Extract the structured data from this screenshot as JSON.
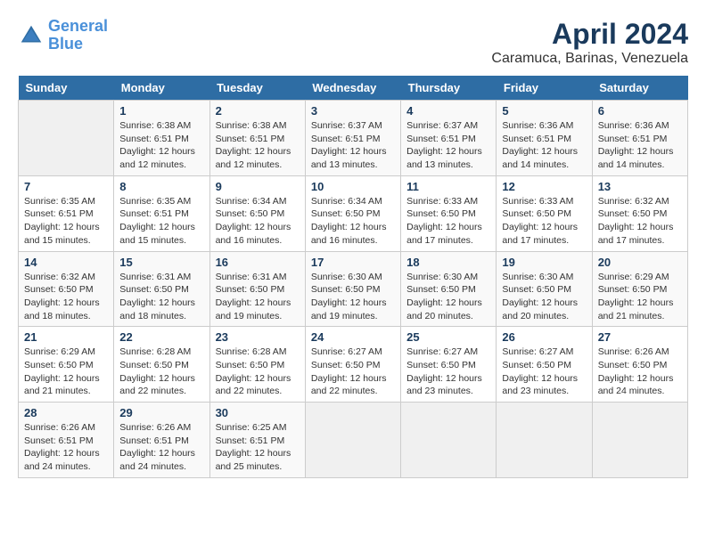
{
  "header": {
    "logo_line1": "General",
    "logo_line2": "Blue",
    "title": "April 2024",
    "subtitle": "Caramuca, Barinas, Venezuela"
  },
  "columns": [
    "Sunday",
    "Monday",
    "Tuesday",
    "Wednesday",
    "Thursday",
    "Friday",
    "Saturday"
  ],
  "weeks": [
    [
      {
        "day": "",
        "sunrise": "",
        "sunset": "",
        "daylight": ""
      },
      {
        "day": "1",
        "sunrise": "Sunrise: 6:38 AM",
        "sunset": "Sunset: 6:51 PM",
        "daylight": "Daylight: 12 hours and 12 minutes."
      },
      {
        "day": "2",
        "sunrise": "Sunrise: 6:38 AM",
        "sunset": "Sunset: 6:51 PM",
        "daylight": "Daylight: 12 hours and 12 minutes."
      },
      {
        "day": "3",
        "sunrise": "Sunrise: 6:37 AM",
        "sunset": "Sunset: 6:51 PM",
        "daylight": "Daylight: 12 hours and 13 minutes."
      },
      {
        "day": "4",
        "sunrise": "Sunrise: 6:37 AM",
        "sunset": "Sunset: 6:51 PM",
        "daylight": "Daylight: 12 hours and 13 minutes."
      },
      {
        "day": "5",
        "sunrise": "Sunrise: 6:36 AM",
        "sunset": "Sunset: 6:51 PM",
        "daylight": "Daylight: 12 hours and 14 minutes."
      },
      {
        "day": "6",
        "sunrise": "Sunrise: 6:36 AM",
        "sunset": "Sunset: 6:51 PM",
        "daylight": "Daylight: 12 hours and 14 minutes."
      }
    ],
    [
      {
        "day": "7",
        "sunrise": "Sunrise: 6:35 AM",
        "sunset": "Sunset: 6:51 PM",
        "daylight": "Daylight: 12 hours and 15 minutes."
      },
      {
        "day": "8",
        "sunrise": "Sunrise: 6:35 AM",
        "sunset": "Sunset: 6:51 PM",
        "daylight": "Daylight: 12 hours and 15 minutes."
      },
      {
        "day": "9",
        "sunrise": "Sunrise: 6:34 AM",
        "sunset": "Sunset: 6:50 PM",
        "daylight": "Daylight: 12 hours and 16 minutes."
      },
      {
        "day": "10",
        "sunrise": "Sunrise: 6:34 AM",
        "sunset": "Sunset: 6:50 PM",
        "daylight": "Daylight: 12 hours and 16 minutes."
      },
      {
        "day": "11",
        "sunrise": "Sunrise: 6:33 AM",
        "sunset": "Sunset: 6:50 PM",
        "daylight": "Daylight: 12 hours and 17 minutes."
      },
      {
        "day": "12",
        "sunrise": "Sunrise: 6:33 AM",
        "sunset": "Sunset: 6:50 PM",
        "daylight": "Daylight: 12 hours and 17 minutes."
      },
      {
        "day": "13",
        "sunrise": "Sunrise: 6:32 AM",
        "sunset": "Sunset: 6:50 PM",
        "daylight": "Daylight: 12 hours and 17 minutes."
      }
    ],
    [
      {
        "day": "14",
        "sunrise": "Sunrise: 6:32 AM",
        "sunset": "Sunset: 6:50 PM",
        "daylight": "Daylight: 12 hours and 18 minutes."
      },
      {
        "day": "15",
        "sunrise": "Sunrise: 6:31 AM",
        "sunset": "Sunset: 6:50 PM",
        "daylight": "Daylight: 12 hours and 18 minutes."
      },
      {
        "day": "16",
        "sunrise": "Sunrise: 6:31 AM",
        "sunset": "Sunset: 6:50 PM",
        "daylight": "Daylight: 12 hours and 19 minutes."
      },
      {
        "day": "17",
        "sunrise": "Sunrise: 6:30 AM",
        "sunset": "Sunset: 6:50 PM",
        "daylight": "Daylight: 12 hours and 19 minutes."
      },
      {
        "day": "18",
        "sunrise": "Sunrise: 6:30 AM",
        "sunset": "Sunset: 6:50 PM",
        "daylight": "Daylight: 12 hours and 20 minutes."
      },
      {
        "day": "19",
        "sunrise": "Sunrise: 6:30 AM",
        "sunset": "Sunset: 6:50 PM",
        "daylight": "Daylight: 12 hours and 20 minutes."
      },
      {
        "day": "20",
        "sunrise": "Sunrise: 6:29 AM",
        "sunset": "Sunset: 6:50 PM",
        "daylight": "Daylight: 12 hours and 21 minutes."
      }
    ],
    [
      {
        "day": "21",
        "sunrise": "Sunrise: 6:29 AM",
        "sunset": "Sunset: 6:50 PM",
        "daylight": "Daylight: 12 hours and 21 minutes."
      },
      {
        "day": "22",
        "sunrise": "Sunrise: 6:28 AM",
        "sunset": "Sunset: 6:50 PM",
        "daylight": "Daylight: 12 hours and 22 minutes."
      },
      {
        "day": "23",
        "sunrise": "Sunrise: 6:28 AM",
        "sunset": "Sunset: 6:50 PM",
        "daylight": "Daylight: 12 hours and 22 minutes."
      },
      {
        "day": "24",
        "sunrise": "Sunrise: 6:27 AM",
        "sunset": "Sunset: 6:50 PM",
        "daylight": "Daylight: 12 hours and 22 minutes."
      },
      {
        "day": "25",
        "sunrise": "Sunrise: 6:27 AM",
        "sunset": "Sunset: 6:50 PM",
        "daylight": "Daylight: 12 hours and 23 minutes."
      },
      {
        "day": "26",
        "sunrise": "Sunrise: 6:27 AM",
        "sunset": "Sunset: 6:50 PM",
        "daylight": "Daylight: 12 hours and 23 minutes."
      },
      {
        "day": "27",
        "sunrise": "Sunrise: 6:26 AM",
        "sunset": "Sunset: 6:50 PM",
        "daylight": "Daylight: 12 hours and 24 minutes."
      }
    ],
    [
      {
        "day": "28",
        "sunrise": "Sunrise: 6:26 AM",
        "sunset": "Sunset: 6:51 PM",
        "daylight": "Daylight: 12 hours and 24 minutes."
      },
      {
        "day": "29",
        "sunrise": "Sunrise: 6:26 AM",
        "sunset": "Sunset: 6:51 PM",
        "daylight": "Daylight: 12 hours and 24 minutes."
      },
      {
        "day": "30",
        "sunrise": "Sunrise: 6:25 AM",
        "sunset": "Sunset: 6:51 PM",
        "daylight": "Daylight: 12 hours and 25 minutes."
      },
      {
        "day": "",
        "sunrise": "",
        "sunset": "",
        "daylight": ""
      },
      {
        "day": "",
        "sunrise": "",
        "sunset": "",
        "daylight": ""
      },
      {
        "day": "",
        "sunrise": "",
        "sunset": "",
        "daylight": ""
      },
      {
        "day": "",
        "sunrise": "",
        "sunset": "",
        "daylight": ""
      }
    ]
  ]
}
